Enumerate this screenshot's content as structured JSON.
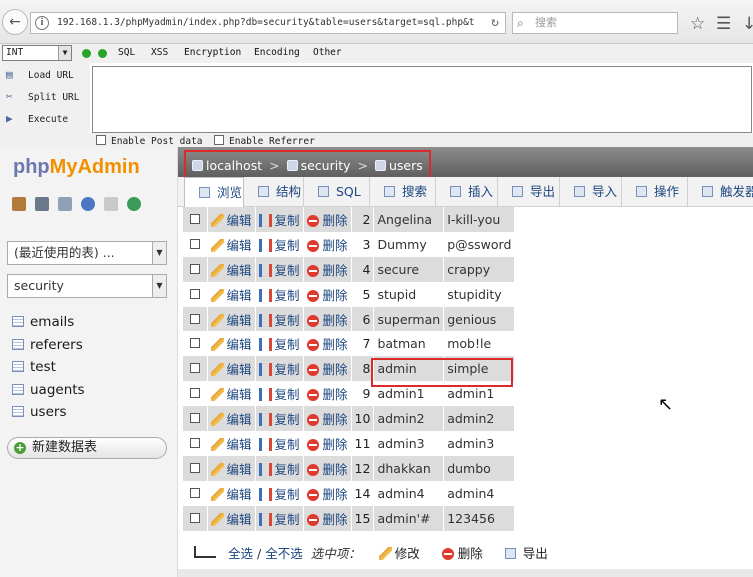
{
  "browser": {
    "url": "192.168.1.3/phpMyadmin/index.php?db=security&table=users&target=sql.php&t",
    "search_placeholder": "搜索",
    "back_icon": "back-arrow",
    "info_icon": "i",
    "reload_icon": "reload"
  },
  "hackbar": {
    "type_select": "INT",
    "menu": [
      "SQL",
      "XSS",
      "Encryption",
      "Encoding",
      "Other"
    ],
    "side": [
      "Load URL",
      "Split URL",
      "Execute"
    ],
    "checks": [
      "Enable Post data",
      "Enable Referrer"
    ]
  },
  "pma": {
    "logo_php": "php",
    "logo_my": "MyAdmin",
    "recent_select": "(最近使用的表) ...",
    "db_select": "security",
    "tables": [
      "emails",
      "referers",
      "test",
      "uagents",
      "users"
    ],
    "new_db": "新建数据表",
    "breadcrumb": {
      "server": "localhost",
      "db": "security",
      "table": "users",
      "sep": ">"
    },
    "tabs": [
      "浏览",
      "结构",
      "SQL",
      "搜索",
      "插入",
      "导出",
      "导入",
      "操作",
      "触发器"
    ],
    "actions": {
      "edit": "编辑",
      "copy": "复制",
      "delete": "删除"
    },
    "rows": [
      {
        "id": "2",
        "username": "Angelina",
        "password": "I-kill-you"
      },
      {
        "id": "3",
        "username": "Dummy",
        "password": "p@ssword"
      },
      {
        "id": "4",
        "username": "secure",
        "password": "crappy"
      },
      {
        "id": "5",
        "username": "stupid",
        "password": "stupidity"
      },
      {
        "id": "6",
        "username": "superman",
        "password": "genious"
      },
      {
        "id": "7",
        "username": "batman",
        "password": "mob!le"
      },
      {
        "id": "8",
        "username": "admin",
        "password": "simple"
      },
      {
        "id": "9",
        "username": "admin1",
        "password": "admin1"
      },
      {
        "id": "10",
        "username": "admin2",
        "password": "admin2"
      },
      {
        "id": "11",
        "username": "admin3",
        "password": "admin3"
      },
      {
        "id": "12",
        "username": "dhakkan",
        "password": "dumbo"
      },
      {
        "id": "14",
        "username": "admin4",
        "password": "admin4"
      },
      {
        "id": "15",
        "username": "admin'#",
        "password": "123456"
      }
    ],
    "footer": {
      "select_all": "全选",
      "slash": "/",
      "deselect_all": "全不选",
      "with_selected": "选中项：",
      "edit": "修改",
      "delete": "删除",
      "export": "导出"
    }
  }
}
